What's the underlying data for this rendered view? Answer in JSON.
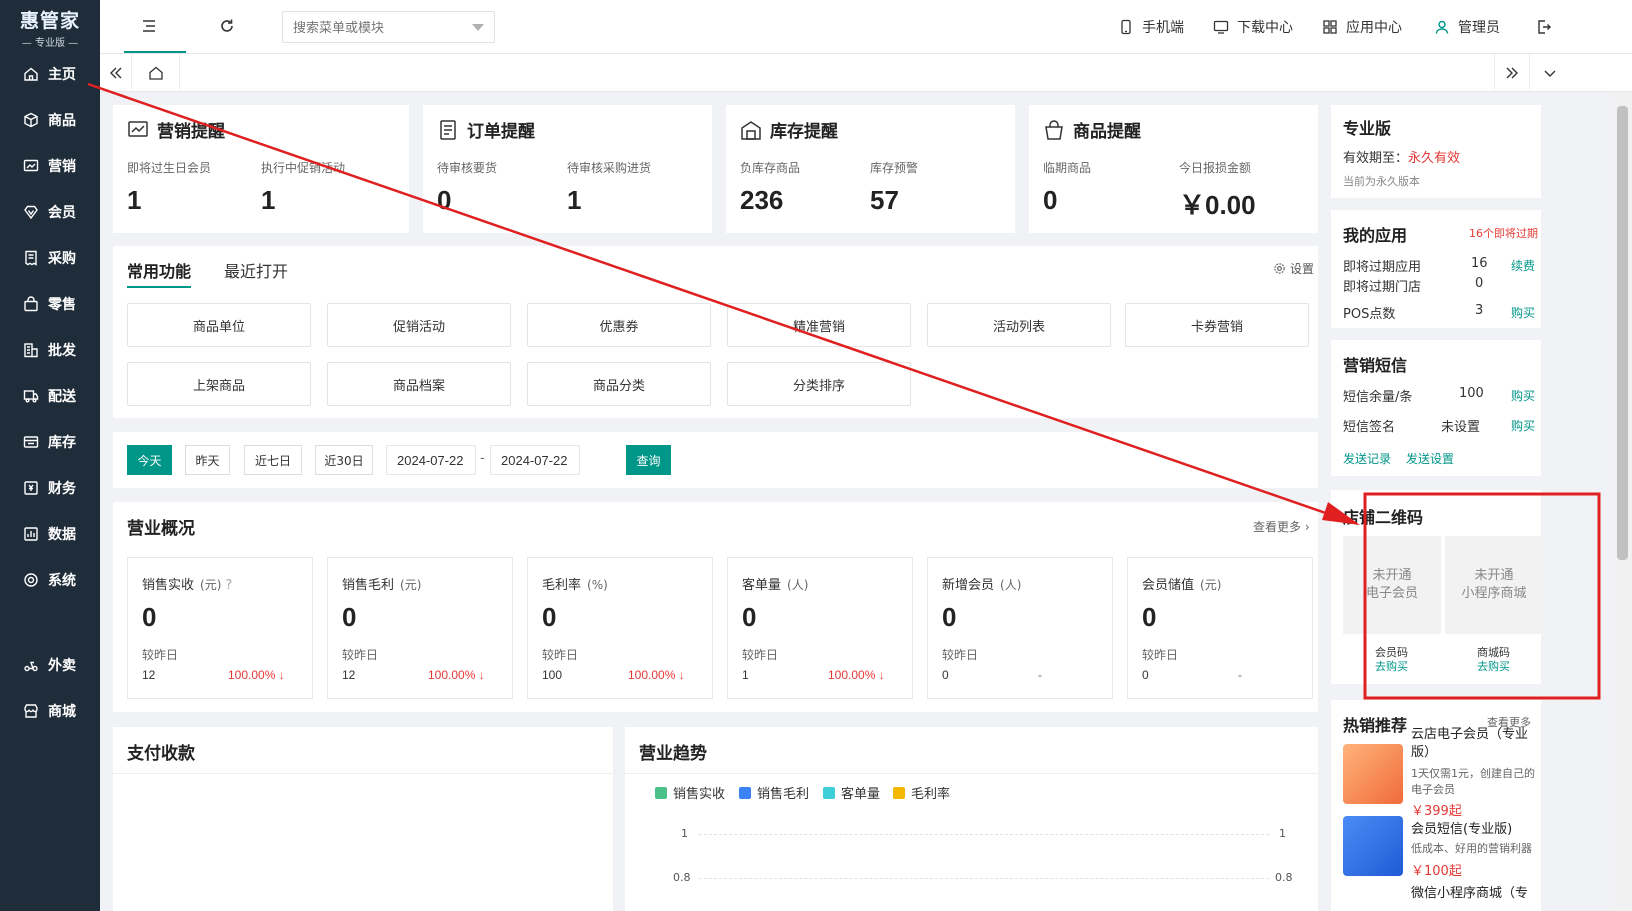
{
  "app": {
    "brand": "惠管家",
    "edition": "专业版"
  },
  "sidebar": {
    "items": [
      {
        "label": "主页",
        "icon": "home-icon"
      },
      {
        "label": "商品",
        "icon": "box-icon"
      },
      {
        "label": "营销",
        "icon": "chart-icon"
      },
      {
        "label": "会员",
        "icon": "diamond-icon"
      },
      {
        "label": "采购",
        "icon": "receipt-icon"
      },
      {
        "label": "零售",
        "icon": "bag-icon"
      },
      {
        "label": "批发",
        "icon": "building-icon"
      },
      {
        "label": "配送",
        "icon": "truck-icon"
      },
      {
        "label": "库存",
        "icon": "warehouse-icon"
      },
      {
        "label": "财务",
        "icon": "finance-icon"
      },
      {
        "label": "数据",
        "icon": "data-icon"
      },
      {
        "label": "系统",
        "icon": "settings-icon"
      },
      {
        "label": "外卖",
        "icon": "takeout-icon"
      },
      {
        "label": "商城",
        "icon": "store-icon"
      }
    ]
  },
  "topbar": {
    "search_placeholder": "搜索菜单或模块",
    "mobile": "手机端",
    "download": "下载中心",
    "apps": "应用中心",
    "user": "管理员"
  },
  "reminders": [
    {
      "title": "营销提醒",
      "icon": "trend-icon",
      "items": [
        {
          "label": "即将过生日会员",
          "value": "1"
        },
        {
          "label": "执行中促销活动",
          "value": "1"
        }
      ]
    },
    {
      "title": "订单提醒",
      "icon": "document-icon",
      "items": [
        {
          "label": "待审核要货",
          "value": "0"
        },
        {
          "label": "待审核采购进货",
          "value": "1"
        }
      ]
    },
    {
      "title": "库存提醒",
      "icon": "warehouse-icon",
      "items": [
        {
          "label": "负库存商品",
          "value": "236"
        },
        {
          "label": "库存预警",
          "value": "57"
        }
      ]
    },
    {
      "title": "商品提醒",
      "icon": "basket-icon",
      "items": [
        {
          "label": "临期商品",
          "value": "0"
        },
        {
          "label": "今日报损金额",
          "value": "￥0.00"
        }
      ]
    }
  ],
  "functions": {
    "tabs": [
      "常用功能",
      "最近打开"
    ],
    "settings": "设置",
    "buttons": [
      "商品单位",
      "促销活动",
      "优惠券",
      "精准营销",
      "活动列表",
      "卡券营销",
      "上架商品",
      "商品档案",
      "商品分类",
      "分类排序"
    ]
  },
  "date_filter": {
    "quick": [
      "今天",
      "昨天",
      "近七日",
      "近30日"
    ],
    "start": "2024-07-22",
    "sep": "-",
    "end": "2024-07-22",
    "query": "查询"
  },
  "overview": {
    "title": "营业概况",
    "more": "查看更多",
    "compare_label": "较昨日",
    "cards": [
      {
        "label": "销售实收",
        "unit": "(元)",
        "value": "0",
        "prev": "12",
        "change": "100.00% ↓"
      },
      {
        "label": "销售毛利",
        "unit": "(元)",
        "value": "0",
        "prev": "12",
        "change": "100.00% ↓"
      },
      {
        "label": "毛利率",
        "unit": "(%)",
        "value": "0",
        "prev": "100",
        "change": "100.00% ↓"
      },
      {
        "label": "客单量",
        "unit": "(人)",
        "value": "0",
        "prev": "1",
        "change": "100.00% ↓"
      },
      {
        "label": "新增会员",
        "unit": "(人)",
        "value": "0",
        "prev": "0",
        "change": "-"
      },
      {
        "label": "会员储值",
        "unit": "(元)",
        "value": "0",
        "prev": "0",
        "change": "-"
      }
    ]
  },
  "payment": {
    "title": "支付收款"
  },
  "trend": {
    "title": "营业趋势",
    "legend": [
      {
        "name": "销售实收",
        "color": "#4cc089"
      },
      {
        "name": "销售毛利",
        "color": "#3b82f6"
      },
      {
        "name": "客单量",
        "color": "#3ccfd8"
      },
      {
        "name": "毛利率",
        "color": "#f5b800"
      }
    ],
    "y_ticks_left": [
      "1",
      "0.8"
    ],
    "y_ticks_right": [
      "1",
      "0.8"
    ]
  },
  "edition_panel": {
    "title": "专业版",
    "validity_label": "有效期至：",
    "validity_value": "永久有效",
    "note": "当前为永久版本"
  },
  "my_apps": {
    "title": "我的应用",
    "badge": "16个即将过期",
    "rows": [
      {
        "label": "即将过期应用",
        "value": "16",
        "action": "续费"
      },
      {
        "label": "即将过期门店",
        "value": "0",
        "action": ""
      },
      {
        "label": "POS点数",
        "value": "3",
        "action": "购买"
      }
    ]
  },
  "sms": {
    "title": "营销短信",
    "rows": [
      {
        "label": "短信余量/条",
        "value": "100",
        "action": "购买"
      },
      {
        "label": "短信签名",
        "value": "未设置",
        "action": "购买"
      }
    ],
    "links": [
      "发送记录",
      "发送设置"
    ]
  },
  "qr": {
    "title": "店铺二维码",
    "items": [
      {
        "box": [
          "未开通",
          "电子会员"
        ],
        "label": "会员码",
        "action": "去购买"
      },
      {
        "box": [
          "未开通",
          "小程序商城"
        ],
        "label": "商城码",
        "action": "去购买"
      }
    ]
  },
  "hot": {
    "title": "热销推荐",
    "more": "查看更多",
    "products": [
      {
        "name": "云店电子会员（专业版）",
        "desc": "1天仅需1元，创建自己的电子会员",
        "price": "￥399起"
      },
      {
        "name": "会员短信(专业版)",
        "desc": "低成本、好用的营销利器",
        "price": "￥100起"
      },
      {
        "name": "微信小程序商城（专",
        "desc": "",
        "price": ""
      }
    ]
  },
  "colors": {
    "sidebar_bg": "#1f2d3a",
    "accent": "#009688",
    "alert_red": "#e53935"
  }
}
